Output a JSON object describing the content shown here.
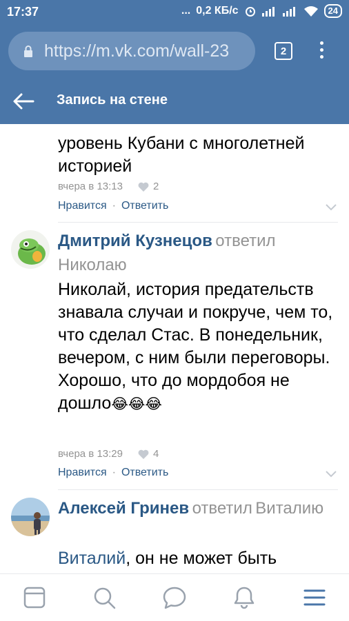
{
  "status_bar": {
    "time": "17:37",
    "dots": "...",
    "speed": "0,2 КБ/с",
    "battery": "24"
  },
  "browser": {
    "url": "https://m.vk.com/wall-23",
    "tab_count": "2"
  },
  "header": {
    "title": "Запись на стене"
  },
  "comments": [
    {
      "text_lines": [
        "уровень Кубани с многолетней",
        "историей"
      ],
      "time": "вчера в 13:13",
      "likes": "2",
      "like_label": "Нравится",
      "reply_label": "Ответить"
    },
    {
      "author": "Дмитрий Кузнецов",
      "replied": "ответил",
      "reply_to": "Николаю",
      "text": "Николай, история предательств знавала случаи и покруче, чем то, что сделал Стас. В понедельник, вечером, с ним были переговоры. Хорошо, что до мордобоя не дошло",
      "emoji": "😂😂😂",
      "time": "вчера в 13:29",
      "likes": "4",
      "like_label": "Нравится",
      "reply_label": "Ответить"
    },
    {
      "author": "Алексей Гринев",
      "replied": "ответил",
      "reply_to": "Виталию",
      "mention": "Виталий",
      "text": ", он не может быть"
    }
  ],
  "bottom_nav": {
    "icons": [
      "feed-icon",
      "search-icon",
      "messages-icon",
      "notifications-icon",
      "menu-icon"
    ],
    "active_color": "#4a76a8",
    "inactive_color": "#99a2ad"
  }
}
